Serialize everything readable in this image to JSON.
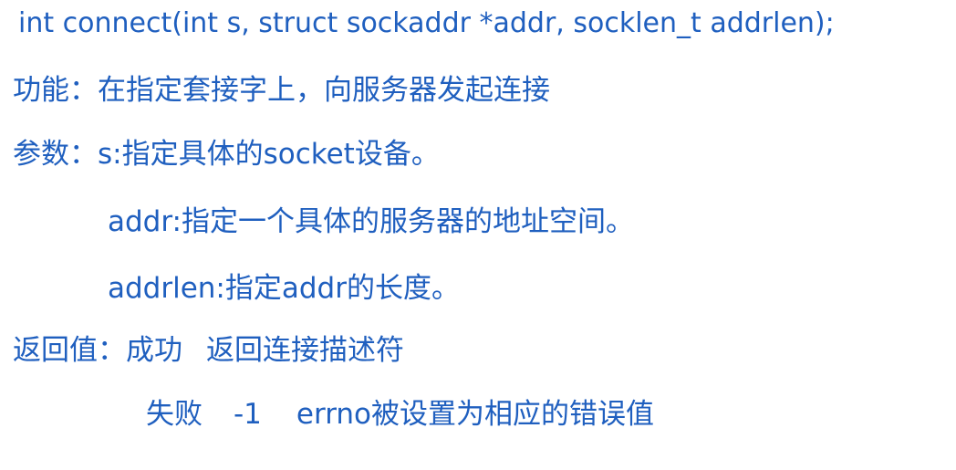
{
  "signature": "int connect(int s, struct sockaddr *addr, socklen_t addrlen);",
  "function_label": "功能：",
  "function_desc": "在指定套接字上，向服务器发起连接",
  "params_label": "参数：",
  "param_s": "s:指定具体的socket设备。",
  "param_addr": "addr:指定一个具体的服务器的地址空间。",
  "param_addrlen": "addrlen:指定addr的长度。",
  "return_label": "返回值：",
  "return_success_label": "成功",
  "return_success_value": "返回连接描述符",
  "return_fail_label": "失败",
  "return_fail_code": "-1",
  "return_fail_desc": "errno被设置为相应的错误值",
  "text_color": "#1f5fbf"
}
